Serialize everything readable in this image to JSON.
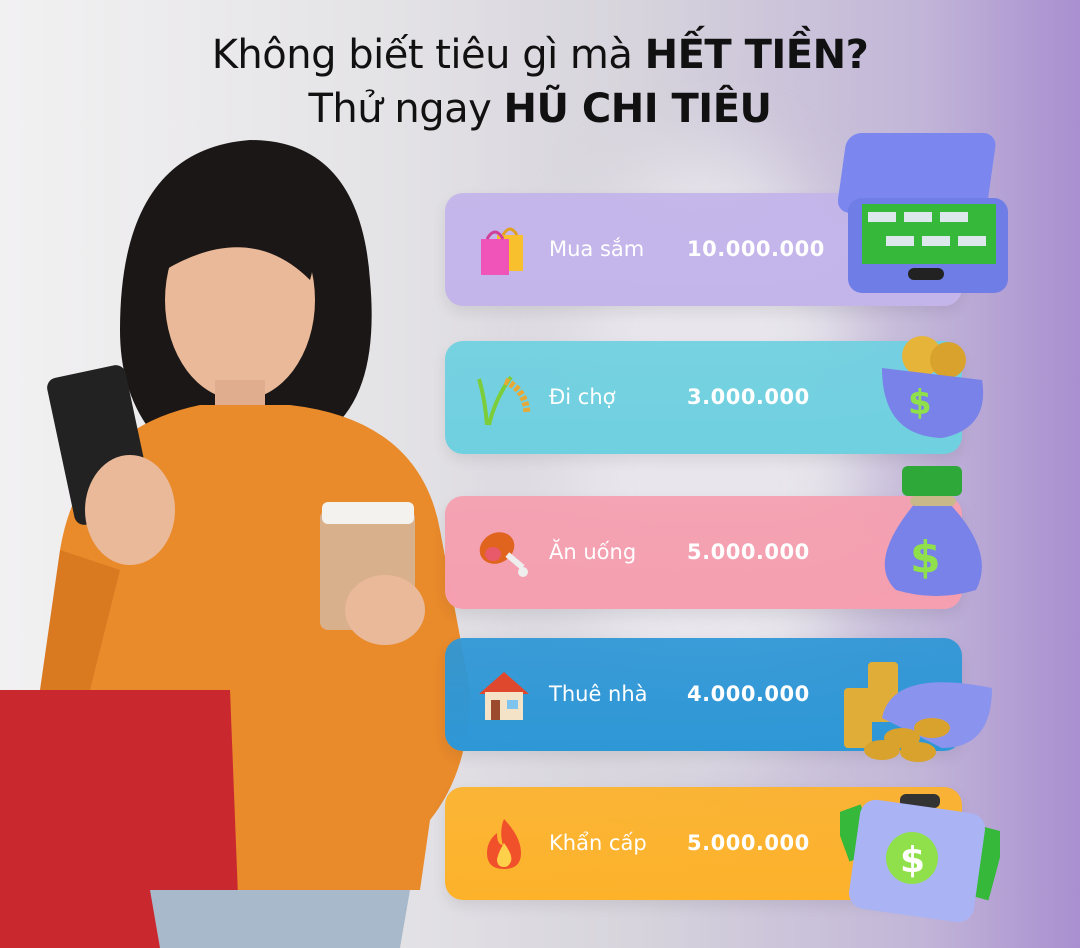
{
  "headline": {
    "line1_prefix": "Không biết tiêu gì mà ",
    "line1_bold": "HẾT TIỀN?",
    "line2_prefix": "Thử ngay ",
    "line2_bold": "HŨ CHI TIÊU"
  },
  "jars": [
    {
      "label": "Mua sắm",
      "value": "10.000.000",
      "color": "#c3b4ea",
      "icon": "shopping-bags-icon",
      "decor": "money-suitcase"
    },
    {
      "label": "Đi chợ",
      "value": "3.000.000",
      "color": "#6fd0e0",
      "icon": "rice-stalk-icon",
      "decor": "coin-purse"
    },
    {
      "label": "Ăn uống",
      "value": "5.000.000",
      "color": "#f59fb0",
      "icon": "meat-on-bone-icon",
      "decor": "money-bag"
    },
    {
      "label": "Thuê nhà",
      "value": "4.000.000",
      "color": "#2e97d6",
      "icon": "house-icon",
      "decor": "coin-sack"
    },
    {
      "label": "Khẩn cấp",
      "value": "5.000.000",
      "color": "#fdb22a",
      "icon": "fire-icon",
      "decor": "money-briefcase"
    }
  ]
}
